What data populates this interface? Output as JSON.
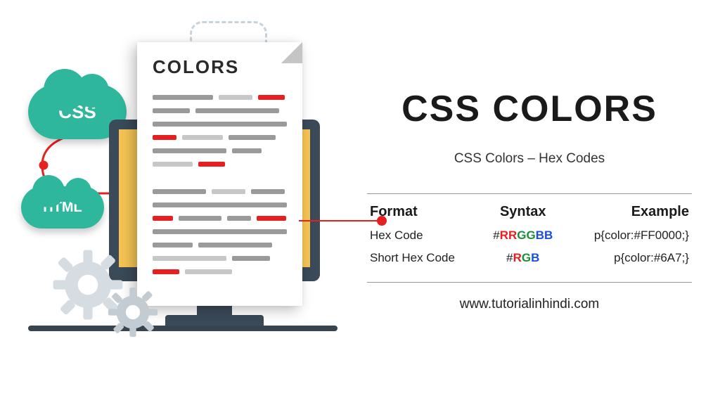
{
  "title": "CSS COLORS",
  "subtitle": "CSS Colors – Hex Codes",
  "doc_heading": "COLORS",
  "clouds": {
    "css": "CSS",
    "html": "HTML"
  },
  "table": {
    "headers": {
      "format": "Format",
      "syntax": "Syntax",
      "example": "Example"
    },
    "rows": [
      {
        "format": "Hex Code",
        "syntax_hash": "#",
        "syntax_r": "RR",
        "syntax_g": "GG",
        "syntax_b": "BB",
        "example": "p{color:#FF0000;}"
      },
      {
        "format": "Short Hex Code",
        "syntax_hash": "#",
        "syntax_r": "R",
        "syntax_g": "G",
        "syntax_b": "B",
        "example": "p{color:#6A7;}"
      }
    ]
  },
  "domain": "www.tutorialinhindi.com"
}
